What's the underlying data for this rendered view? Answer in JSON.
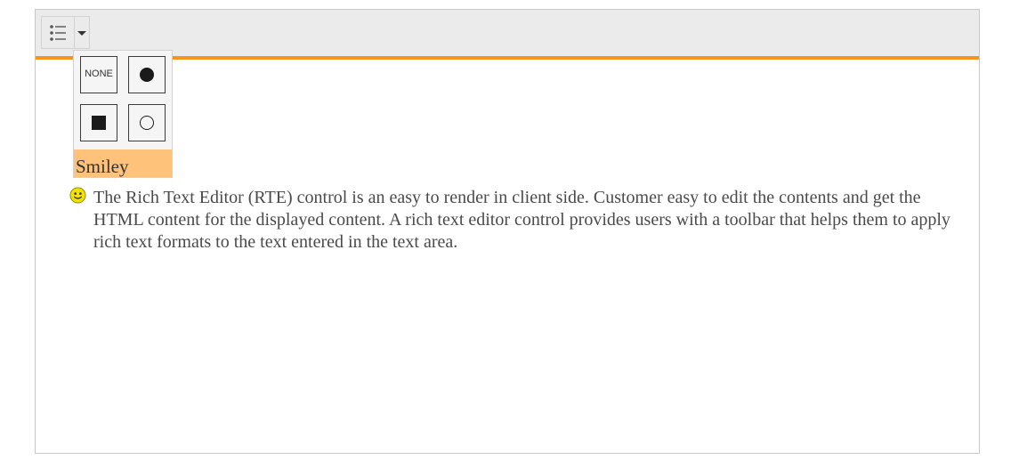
{
  "toolbar": {
    "list_button_icon": "unordered-list-icon",
    "dropdown_icon": "caret-down-icon",
    "accent_color": "#f7941d"
  },
  "list_style_popup": {
    "options": [
      {
        "id": "none",
        "label": "NONE"
      },
      {
        "id": "disc",
        "icon": "filled-circle-icon"
      },
      {
        "id": "square",
        "icon": "filled-square-icon"
      },
      {
        "id": "circle",
        "icon": "hollow-circle-icon"
      }
    ],
    "highlighted_item": "Smiley",
    "highlight_color": "#ffc27a"
  },
  "editor": {
    "bullet_icon": "smiley-icon",
    "text": "The Rich Text Editor (RTE) control is an easy to render in client side. Customer easy to edit the contents and get the HTML content for the displayed content. A rich text editor control provides users with a toolbar that helps them to apply rich text formats to the text entered in the text area."
  }
}
